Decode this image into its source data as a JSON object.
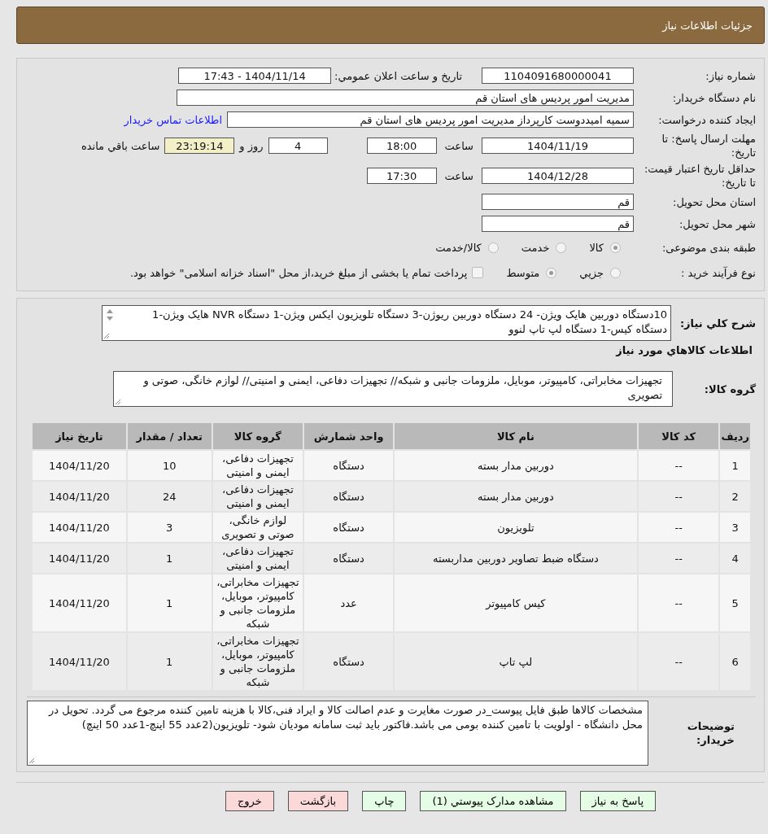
{
  "header": {
    "title": "جزئیات اطلاعات نیاز"
  },
  "info": {
    "need_number": {
      "label": "شماره نیاز:",
      "value": "1104091680000041"
    },
    "announce": {
      "label": "تاریخ و ساعت اعلان عمومي:",
      "value": "1404/11/14 - 17:43"
    },
    "buyer_org": {
      "label": "نام دستگاه خریدار:",
      "value": "مدیریت امور پردیس های استان قم"
    },
    "requester": {
      "label": "ایجاد کننده درخواست:",
      "value": "سمیه امیددوست کارپرداز مدیریت امور پردیس های استان قم",
      "link": "اطلاعات تماس خریدار"
    },
    "deadline": {
      "label": "مهلت ارسال پاسخ: تا تاریخ:",
      "date": "1404/11/19",
      "time_label": "ساعت",
      "time": "18:00",
      "days": "4",
      "days_label": "روز و",
      "remaining": "23:19:14",
      "remaining_label": "ساعت باقي مانده"
    },
    "validity": {
      "label": "حداقل تاریخ اعتبار قیمت: تا تاریخ:",
      "date": "1404/12/28",
      "time_label": "ساعت",
      "time": "17:30"
    },
    "province": {
      "label": "استان محل تحویل:",
      "value": "قم"
    },
    "city": {
      "label": "شهر محل تحویل:",
      "value": "قم"
    },
    "category": {
      "label": "طبقه بندی موضوعی:",
      "options": [
        {
          "label": "کالا",
          "selected": true
        },
        {
          "label": "خدمت",
          "selected": false
        },
        {
          "label": "کالا/خدمت",
          "selected": false
        }
      ]
    },
    "process": {
      "label": "نوع فرآیند خرید :",
      "options": [
        {
          "label": "جزيي",
          "selected": false
        },
        {
          "label": "متوسط",
          "selected": true
        }
      ],
      "treasury": {
        "label": "پرداخت تمام یا بخشی از مبلغ خرید،از محل \"اسناد خزانه اسلامی\" خواهد بود.",
        "checked": false
      }
    }
  },
  "summary": {
    "label": "شرح کلي نياز:",
    "value": "10دستگاه دوربین هایک ویژن- 24 دستگاه دوربین ریوژن-3 دستگاه تلویزیون ایکس ویژن-1 دستگاه  NVR هایک ویژن-1 دستگاه کیس-1 دستگاه لپ تاپ لنوو"
  },
  "goods_heading": "اطلاعات کالاهاي مورد نياز",
  "goods_group": {
    "label": "گروه کالا:",
    "value": "تجهیزات مخابراتی، کامپیوتر، موبایل، ملزومات جانبی و شبکه// تجهیزات دفاعی، ایمنی و امنیتی// لوازم خانگی، صوتی و تصویری"
  },
  "table": {
    "columns": [
      "ردیف",
      "کد کالا",
      "نام کالا",
      "واحد شمارش",
      "گروه کالا",
      "تعداد / مقدار",
      "تاریخ نیاز"
    ],
    "rows": [
      [
        "1",
        "--",
        "دوربین مدار بسته",
        "دستگاه",
        "تجهیزات دفاعی، ایمنی و امنیتی",
        "10",
        "1404/11/20"
      ],
      [
        "2",
        "--",
        "دوربین مدار بسته",
        "دستگاه",
        "تجهیزات دفاعی، ایمنی و امنیتی",
        "24",
        "1404/11/20"
      ],
      [
        "3",
        "--",
        "تلویزیون",
        "دستگاه",
        "لوازم خانگی، صوتی و تصویری",
        "3",
        "1404/11/20"
      ],
      [
        "4",
        "--",
        "دستگاه ضبط تصاویر دوربین مداربسته",
        "دستگاه",
        "تجهیزات دفاعی، ایمنی و امنیتی",
        "1",
        "1404/11/20"
      ],
      [
        "5",
        "--",
        "کیس کامپیوتر",
        "عدد",
        "تجهیزات مخابراتی، کامپیوتر، موبایل، ملزومات جانبی و شبکه",
        "1",
        "1404/11/20"
      ],
      [
        "6",
        "--",
        "لپ تاپ",
        "دستگاه",
        "تجهیزات مخابراتی، کامپیوتر، موبایل، ملزومات جانبی و شبکه",
        "1",
        "1404/11/20"
      ]
    ]
  },
  "buyer_notes": {
    "label": "توضیحات خریدار:",
    "value": "مشخصات کالاها  طبق فایل پیوست_در صورت مغایرت و عدم اصالت کالا و ایراد فنی،کالا با هزینه تامین کننده مرجوع می گردد. تحویل در محل دانشگاه - اولویت با تامین کننده بومی می باشد.فاکتور باید ثبت سامانه مودیان شود- تلویزیون(2عدد 55 اینچ-1عدد 50 اینچ)"
  },
  "buttons": [
    {
      "label": "پاسخ به نیاز",
      "kind": "go"
    },
    {
      "label": "مشاهده مدارک پیوستي (1)",
      "kind": "go"
    },
    {
      "label": "چاپ",
      "kind": "go"
    },
    {
      "label": "بازگشت",
      "kind": "stop"
    },
    {
      "label": "خروج",
      "kind": "stop"
    }
  ]
}
